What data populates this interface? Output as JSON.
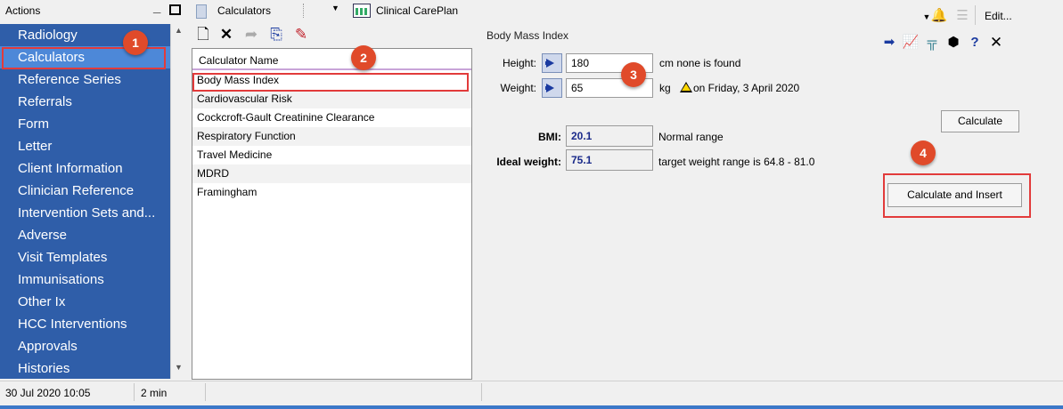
{
  "actions": {
    "title": "Actions",
    "items": [
      {
        "label": "Radiology"
      },
      {
        "label": "Calculators",
        "selected": true
      },
      {
        "label": "Reference Series"
      },
      {
        "label": "Referrals"
      },
      {
        "label": "Form"
      },
      {
        "label": "Letter"
      },
      {
        "label": "Client Information"
      },
      {
        "label": "Clinician Reference"
      },
      {
        "label": "Intervention Sets and..."
      },
      {
        "label": "Adverse"
      },
      {
        "label": "Visit Templates"
      },
      {
        "label": "Immunisations"
      },
      {
        "label": "Other Ix"
      },
      {
        "label": "HCC Interventions"
      },
      {
        "label": "Approvals"
      },
      {
        "label": "Histories"
      }
    ],
    "accent": "#2f5ea9",
    "selected_color": "#4d88d8"
  },
  "calculators": {
    "title": "Calculators",
    "careplan_label": "Clinical CarePlan",
    "toolbar_icons": [
      "new-document-icon",
      "delete-icon",
      "export-icon",
      "copy-icon",
      "palette-icon"
    ],
    "column_header": "Calculator Name",
    "rows": [
      "Body Mass Index",
      "Cardiovascular Risk",
      "Cockcroft-Gault Creatinine Clearance",
      "Respiratory Function",
      "Travel Medicine",
      "MDRD",
      "Framingham"
    ]
  },
  "bmi": {
    "header": "Body Mass Index",
    "height_label": "Height:",
    "height_value": "180",
    "height_note": "cm none is found",
    "weight_label": "Weight:",
    "weight_value": "65",
    "weight_unit": "kg",
    "weight_note": "on Friday, 3 April 2020",
    "calculate_label": "Calculate",
    "bmi_label": "BMI:",
    "bmi_value": "20.1",
    "bmi_note": "Normal range",
    "ideal_label": "Ideal weight:",
    "ideal_value": "75.1",
    "ideal_note": "target weight range is 64.8 - 81.0",
    "insert_label": "Calculate and Insert"
  },
  "right_toolbar": {
    "edit_label": "Edit...",
    "icons": [
      "bell-icon",
      "list-icon",
      "arrow-right-icon",
      "chart-icon",
      "table-icon",
      "cube-icon",
      "help-icon",
      "close-icon"
    ]
  },
  "callouts": [
    "1",
    "2",
    "3",
    "4"
  ],
  "callout_color": "#e23b3b",
  "status": {
    "date": "30 Jul 2020 10:05",
    "duration": "2 min"
  }
}
